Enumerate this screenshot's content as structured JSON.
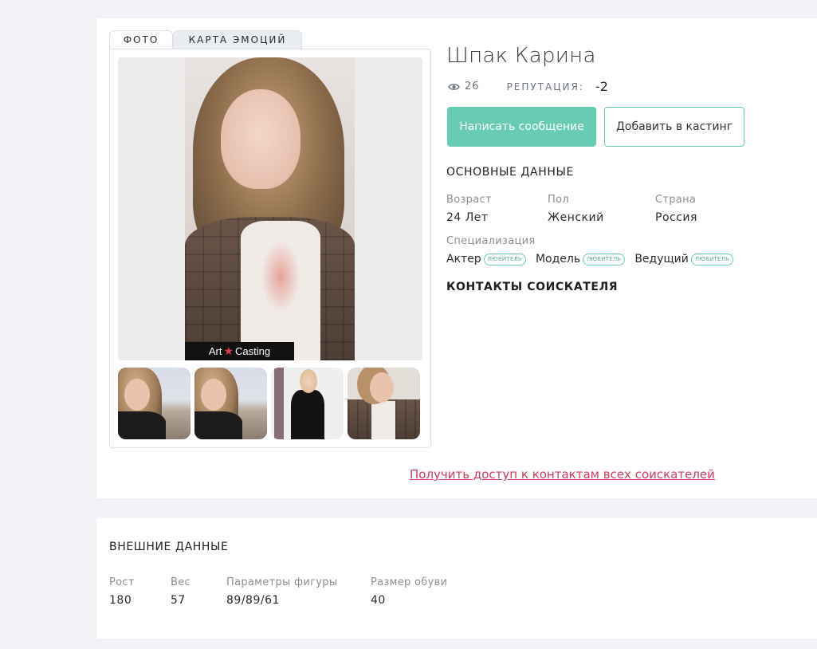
{
  "tabs": [
    {
      "label": "ФОТО"
    },
    {
      "label": "КАРТА ЭМОЦИЙ"
    }
  ],
  "photo": {
    "watermark_prefix": "Art",
    "watermark_suffix": "Casting"
  },
  "profile": {
    "name": "Шпак Карина",
    "views": "26",
    "reputation_label": "РЕПУТАЦИЯ:",
    "reputation_value": "-2"
  },
  "actions": {
    "message_label": "Написать сообщение",
    "casting_label": "Добавить в кастинг"
  },
  "basic": {
    "title": "ОСНОВНЫЕ ДАННЫЕ",
    "age_label": "Возраст",
    "age_value": "24 Лет",
    "gender_label": "Пол",
    "gender_value": "Женский",
    "country_label": "Страна",
    "country_value": "Россия",
    "spec_label": "Специализация",
    "specializations": [
      {
        "name": "Актер",
        "level": "любитель"
      },
      {
        "name": "Модель",
        "level": "любитель"
      },
      {
        "name": "Ведущий",
        "level": "любитель"
      }
    ]
  },
  "contacts": {
    "title": "КОНТАКТЫ СОИСКАТЕЛЯ",
    "access_link": "Получить доступ к контактам всех соискателей"
  },
  "external": {
    "title": "ВНЕШНИЕ ДАННЫЕ",
    "height_label": "Рост",
    "height_value": "180",
    "weight_label": "Вес",
    "weight_value": "57",
    "figure_label": "Параметры фигуры",
    "figure_value": "89/89/61",
    "shoe_label": "Размер обуви",
    "shoe_value": "40"
  },
  "colors": {
    "accent": "#68cbb3",
    "link": "#d13b60",
    "background": "#f2f3f7"
  }
}
